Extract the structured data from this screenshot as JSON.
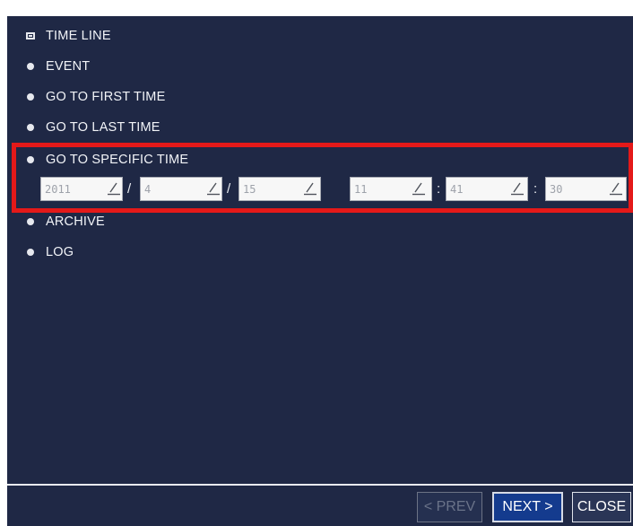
{
  "menu": {
    "items": [
      {
        "label": "TIME LINE",
        "icon": "selected-mark-icon",
        "selected": true
      },
      {
        "label": "EVENT",
        "icon": "bullet-icon"
      },
      {
        "label": "GO TO FIRST TIME",
        "icon": "bullet-icon"
      },
      {
        "label": "GO TO LAST TIME",
        "icon": "bullet-icon"
      },
      {
        "label": "GO TO SPECIFIC TIME",
        "icon": "bullet-icon"
      },
      {
        "label": "ARCHIVE",
        "icon": "bullet-icon"
      },
      {
        "label": "LOG",
        "icon": "bullet-icon"
      }
    ]
  },
  "specific_time": {
    "year": "2011",
    "month": "4",
    "day": "15",
    "hour": "11",
    "minute": "41",
    "second": "30",
    "date_separator": "/",
    "time_separator": ":"
  },
  "footer": {
    "prev_label": "< PREV",
    "next_label": "NEXT >",
    "close_label": "CLOSE"
  },
  "colors": {
    "background": "#1f2845",
    "highlight": "#e41919",
    "text": "#f2f4f8",
    "field_bg": "#f7f7f7",
    "next_button": "#143b8e"
  }
}
